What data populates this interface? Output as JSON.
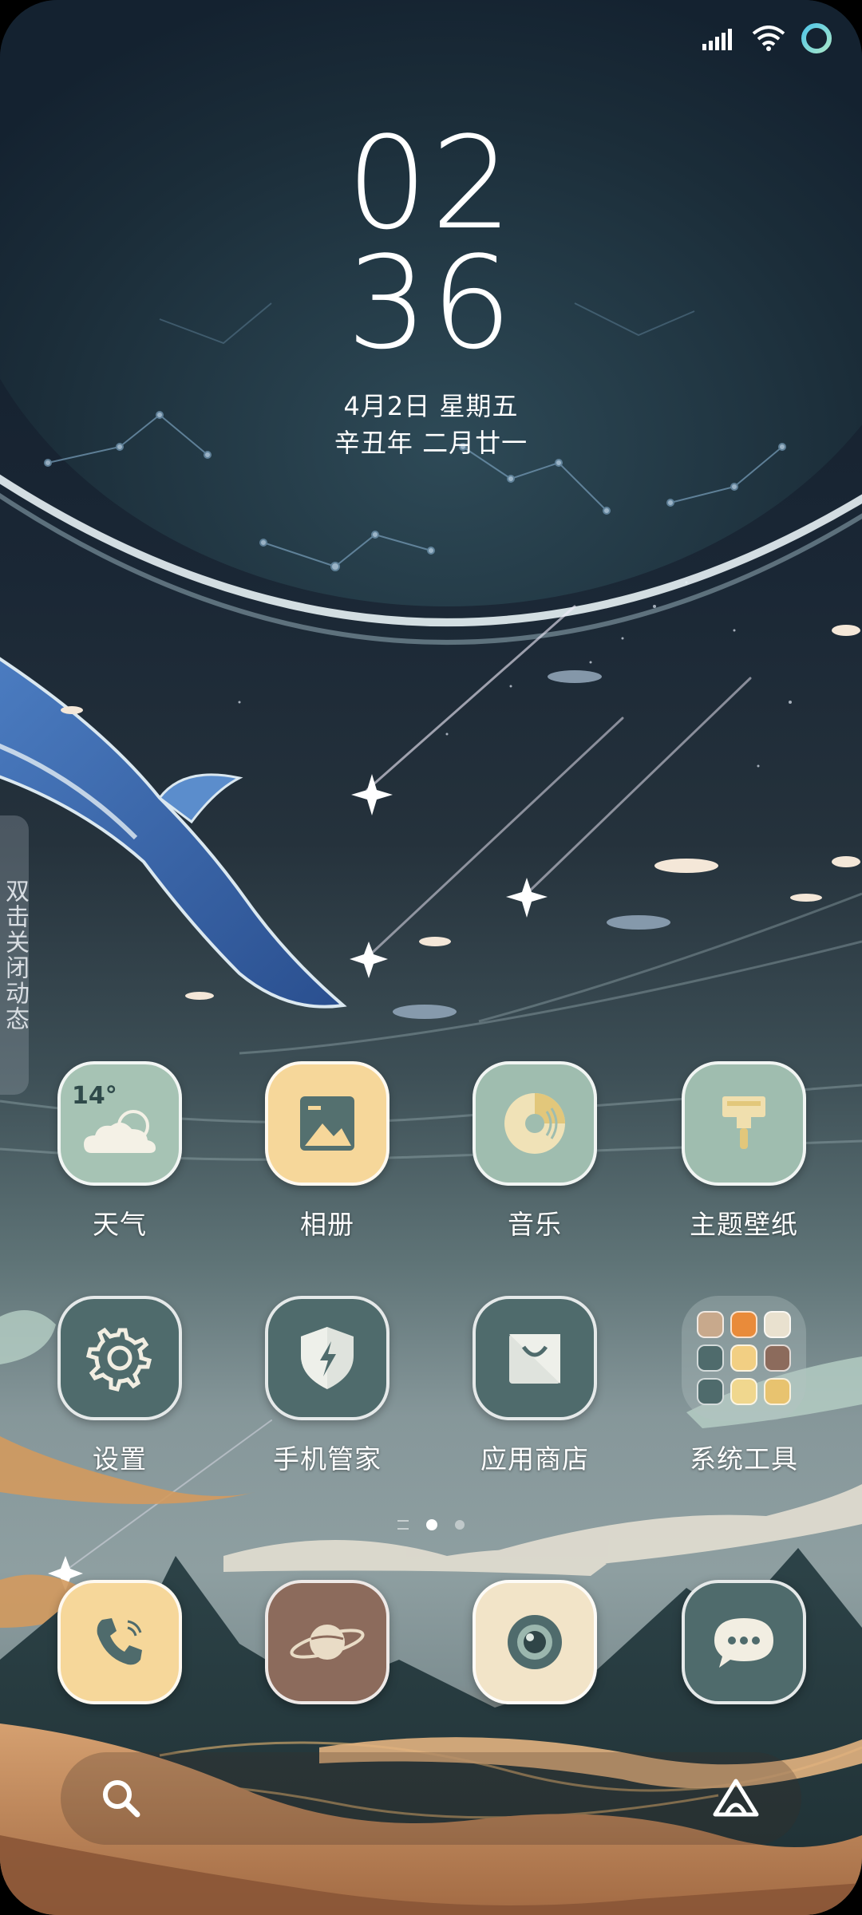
{
  "lockscreen": {
    "hours": "02",
    "minutes": "36",
    "date": "4月2日 星期五",
    "lunar_date": "辛丑年 二月廿一"
  },
  "status_bar": {
    "icons": [
      "signal-icon",
      "wifi-icon",
      "status-ring-icon"
    ]
  },
  "side_hint": {
    "text": "双击关闭动态"
  },
  "apps": [
    {
      "label": "天气",
      "icon": "weather-icon",
      "temp": "14°",
      "color": "#a6c3b4"
    },
    {
      "label": "相册",
      "icon": "gallery-icon",
      "color": "#f6d79a"
    },
    {
      "label": "音乐",
      "icon": "music-icon",
      "color": "#9fbdaf"
    },
    {
      "label": "主题壁纸",
      "icon": "theme-brush-icon",
      "color": "#9fbdaf"
    },
    {
      "label": "设置",
      "icon": "gear-icon",
      "color": "#4f6b6c"
    },
    {
      "label": "手机管家",
      "icon": "security-shield-icon",
      "color": "#4f6b6c"
    },
    {
      "label": "应用商店",
      "icon": "app-store-bag-icon",
      "color": "#4f6b6c"
    },
    {
      "label": "系统工具",
      "icon": "folder-icon"
    }
  ],
  "dock": [
    {
      "name": "phone",
      "icon": "phone-icon",
      "color": "#f6d79a"
    },
    {
      "name": "browser",
      "icon": "planet-icon",
      "color": "#8c6b5c"
    },
    {
      "name": "camera",
      "icon": "camera-icon",
      "color": "#f2e4c8"
    },
    {
      "name": "messages",
      "icon": "message-bubble-icon",
      "color": "#4f6b6c"
    }
  ],
  "page_indicator": {
    "pages": 3,
    "active": 2
  },
  "search_bar": {
    "icons": [
      "search-icon",
      "assistant-icon"
    ]
  }
}
